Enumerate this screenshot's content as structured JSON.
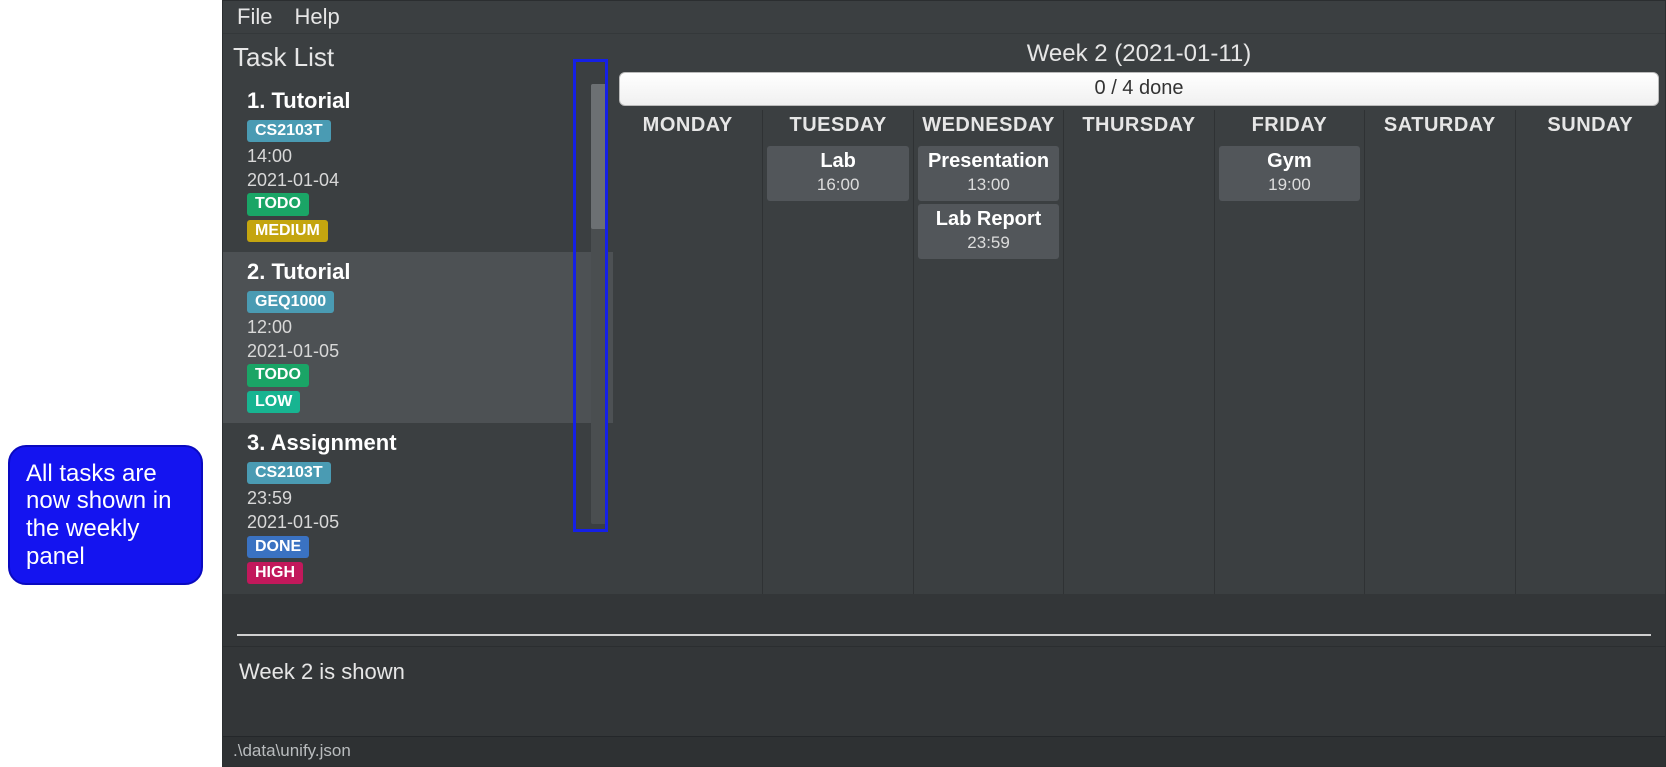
{
  "callout": {
    "text": "All tasks are now shown in the weekly panel"
  },
  "menubar": {
    "file": "File",
    "help": "Help"
  },
  "tasklist": {
    "title": "Task List",
    "items": [
      {
        "index": "1.",
        "name": "Tutorial",
        "module": "CS2103T",
        "time": "14:00",
        "date": "2021-01-04",
        "status": "TODO",
        "status_class": "tag-todo",
        "priority": "MEDIUM",
        "priority_class": "tag-medium",
        "alt": false
      },
      {
        "index": "2.",
        "name": "Tutorial",
        "module": "GEQ1000",
        "time": "12:00",
        "date": "2021-01-05",
        "status": "TODO",
        "status_class": "tag-todo",
        "priority": "LOW",
        "priority_class": "tag-low",
        "alt": true
      },
      {
        "index": "3.",
        "name": "Assignment",
        "module": "CS2103T",
        "time": "23:59",
        "date": "2021-01-05",
        "status": "DONE",
        "status_class": "tag-done",
        "priority": "HIGH",
        "priority_class": "tag-high",
        "alt": false
      }
    ]
  },
  "week": {
    "title": "Week 2 (2021-01-11)",
    "done_bar": "0 / 4 done",
    "days": [
      {
        "label": "MONDAY",
        "events": []
      },
      {
        "label": "TUESDAY",
        "events": [
          {
            "title": "Lab",
            "time": "16:00"
          }
        ]
      },
      {
        "label": "WEDNESDAY",
        "events": [
          {
            "title": "Presentation",
            "time": "13:00"
          },
          {
            "title": "Lab Report",
            "time": "23:59"
          }
        ]
      },
      {
        "label": "THURSDAY",
        "events": []
      },
      {
        "label": "FRIDAY",
        "events": [
          {
            "title": "Gym",
            "time": "19:00"
          }
        ]
      },
      {
        "label": "SATURDAY",
        "events": []
      },
      {
        "label": "SUNDAY",
        "events": []
      }
    ]
  },
  "console": {
    "text": "Week 2 is shown"
  },
  "statusbar": {
    "path": ".\\data\\unify.json"
  }
}
